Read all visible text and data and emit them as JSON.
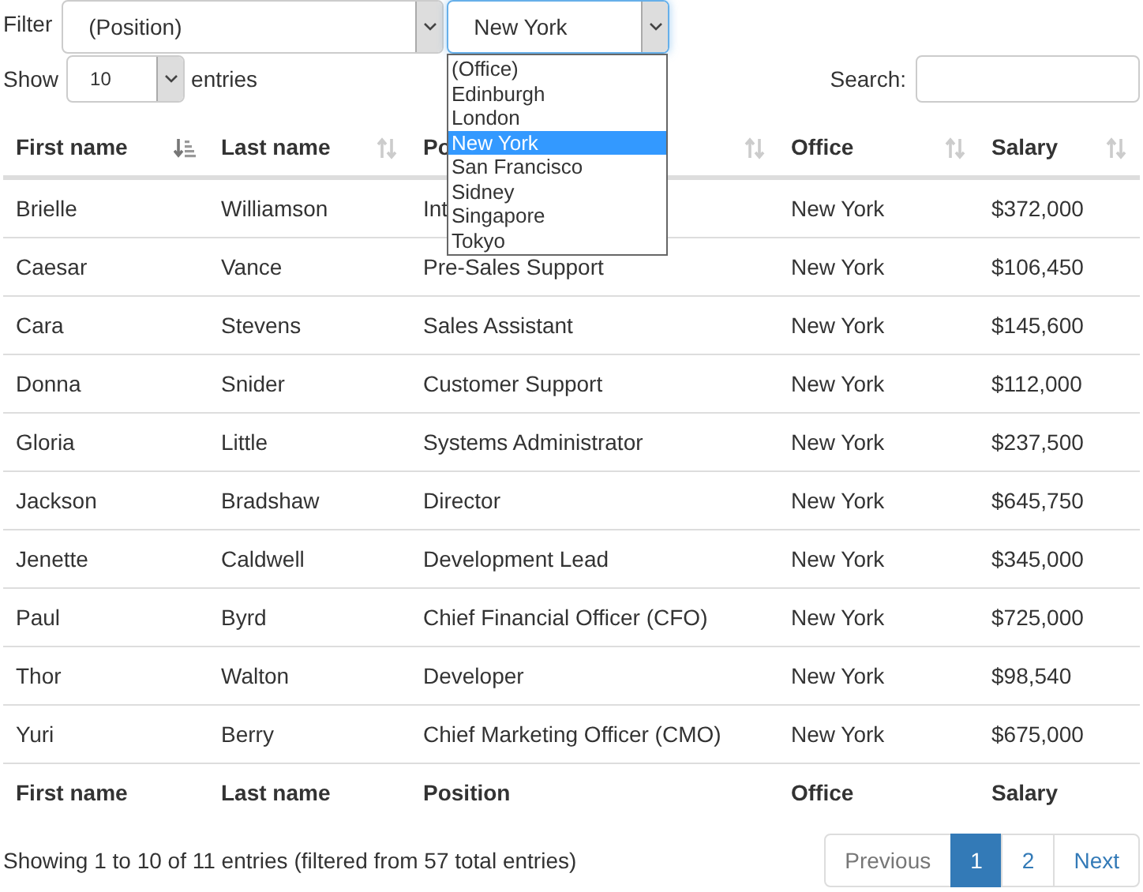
{
  "filter": {
    "label": "Filter",
    "position_select": {
      "value": "(Position)"
    },
    "office_select": {
      "value": "New York",
      "open": true,
      "options": [
        {
          "label": "(Office)",
          "selected": false
        },
        {
          "label": "Edinburgh",
          "selected": false
        },
        {
          "label": "London",
          "selected": false
        },
        {
          "label": "New York",
          "selected": true
        },
        {
          "label": "San Francisco",
          "selected": false
        },
        {
          "label": "Sidney",
          "selected": false
        },
        {
          "label": "Singapore",
          "selected": false
        },
        {
          "label": "Tokyo",
          "selected": false
        }
      ]
    }
  },
  "length": {
    "label_before": "Show",
    "value": "10",
    "label_after": "entries"
  },
  "search": {
    "label": "Search:"
  },
  "table": {
    "columns": [
      {
        "label": "First name",
        "sorted": true
      },
      {
        "label": "Last name",
        "sorted": false
      },
      {
        "label": "Po",
        "sorted": false
      },
      {
        "label": "Office",
        "sorted": false
      },
      {
        "label": "Salary",
        "sorted": false
      }
    ],
    "rows": [
      [
        "Brielle",
        "Williamson",
        "Int",
        "New York",
        "$372,000"
      ],
      [
        "Caesar",
        "Vance",
        "Pre-Sales Support",
        "New York",
        "$106,450"
      ],
      [
        "Cara",
        "Stevens",
        "Sales Assistant",
        "New York",
        "$145,600"
      ],
      [
        "Donna",
        "Snider",
        "Customer Support",
        "New York",
        "$112,000"
      ],
      [
        "Gloria",
        "Little",
        "Systems Administrator",
        "New York",
        "$237,500"
      ],
      [
        "Jackson",
        "Bradshaw",
        "Director",
        "New York",
        "$645,750"
      ],
      [
        "Jenette",
        "Caldwell",
        "Development Lead",
        "New York",
        "$345,000"
      ],
      [
        "Paul",
        "Byrd",
        "Chief Financial Officer (CFO)",
        "New York",
        "$725,000"
      ],
      [
        "Thor",
        "Walton",
        "Developer",
        "New York",
        "$98,540"
      ],
      [
        "Yuri",
        "Berry",
        "Chief Marketing Officer (CMO)",
        "New York",
        "$675,000"
      ]
    ],
    "footer": [
      "First name",
      "Last name",
      "Position",
      "Office",
      "Salary"
    ]
  },
  "info": "Showing 1 to 10 of 11 entries (filtered from 57 total entries)",
  "pagination": [
    {
      "label": "Previous",
      "kind": "nav",
      "selected": false
    },
    {
      "label": "1",
      "kind": "page",
      "selected": true
    },
    {
      "label": "2",
      "kind": "page",
      "selected": false
    },
    {
      "label": "Next",
      "kind": "nav",
      "selected": false
    }
  ]
}
